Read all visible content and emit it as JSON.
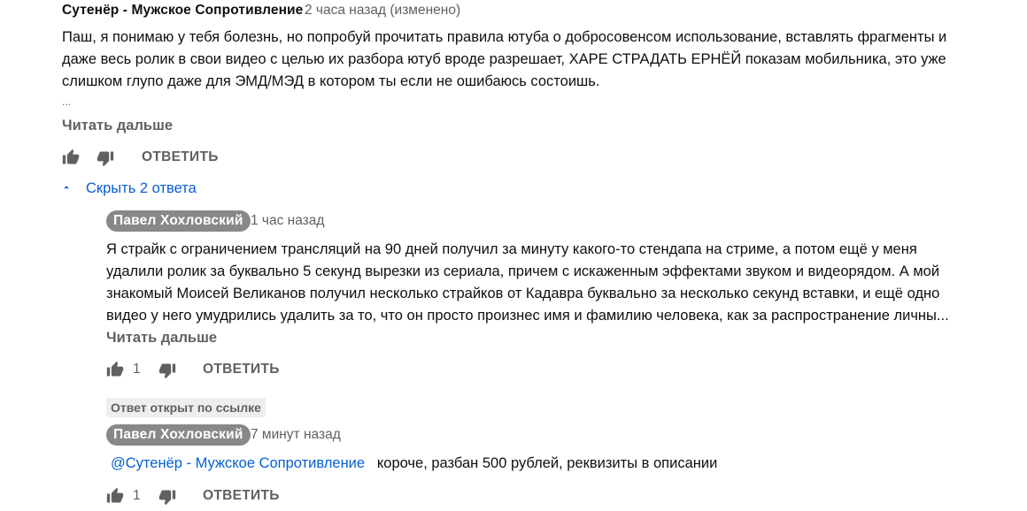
{
  "top_comment": {
    "author": "Сутенёр - Мужское Сопротивление",
    "time": "2 часа назад (изменено)",
    "lines": [
      "Паш, я понимаю у тебя болезнь, но попробуй прочитать правила ютуба о добросовенсом использование, вставлять фрагменты и",
      "даже весь ролик в свои видео с целью их разбора ютуб вроде разрешает, ХАРЕ СТРАДАТЬ ЕРНЁЙ  показам мобильника, это уже",
      "слишком глупо даже для ЭМД/МЭД в котором ты если не ошибаюсь состоишь."
    ],
    "ellipsis": "...",
    "read_more": "Читать дальше",
    "reply_label": "ОТВЕТИТЬ"
  },
  "replies_toggle": {
    "label": "Скрыть 2 ответа"
  },
  "replies": [
    {
      "author": "Павел Хохловский",
      "time": "1 час назад",
      "lines": [
        "Я страйк с ограничением трансляций на 90 дней получил за минуту какого-то стендапа на стриме, а потом ещё у меня",
        "удалили ролик за буквально 5 секунд вырезки из сериала, причем с искаженным эффектами звуком и видеорядом. А мой",
        "знакомый Моисей Великанов получил несколько страйков от Кадавра буквально за несколько секунд вставки, и ещё одно",
        "видео у него умудрились удалить за то, что он просто произнес имя и фамилию человека, как за распространение личны..."
      ],
      "read_more": "Читать дальше",
      "likes": "1",
      "reply_label": "ОТВЕТИТЬ"
    },
    {
      "badge": "Ответ открыт по ссылке",
      "author": "Павел Хохловский",
      "time": "7 минут назад",
      "mention": "@Сутенёр - Мужское Сопротивление",
      "text": "короче, разбан 500 рублей, реквизиты в описании",
      "likes": "1",
      "reply_label": "ОТВЕТИТЬ"
    }
  ],
  "icons": {
    "like": "thumbs-up-icon",
    "dislike": "thumbs-down-icon",
    "collapse": "chevron-up-icon"
  },
  "colors": {
    "link": "#065fd4",
    "secondary_text": "#606060",
    "author_pill": "#888888"
  }
}
